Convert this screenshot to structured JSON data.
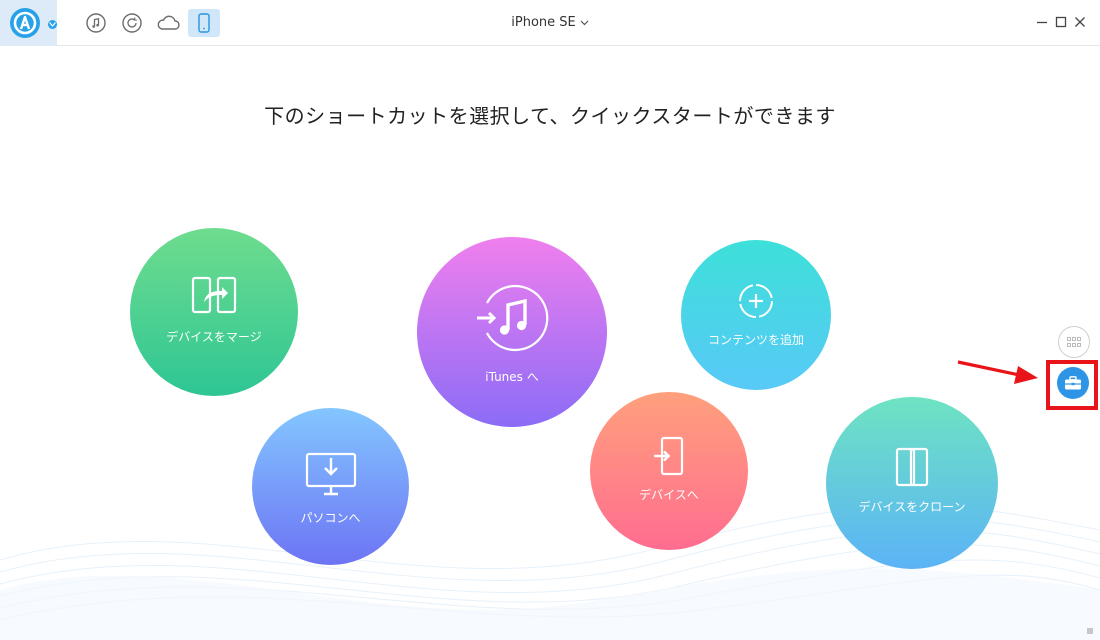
{
  "titlebar": {
    "device_name": "iPhone SE",
    "nav_icons": [
      "music-icon",
      "restore-icon",
      "cloud-icon",
      "device-icon"
    ],
    "window_controls": [
      "minimize-icon",
      "maximize-icon",
      "close-icon"
    ]
  },
  "main": {
    "headline": "下のショートカットを選択して、クイックスタートができます",
    "shortcuts": [
      {
        "label": "デバイスをマージ",
        "icon": "merge-device-icon"
      },
      {
        "label": "パソコンへ",
        "icon": "to-computer-icon"
      },
      {
        "label": "iTunes へ",
        "icon": "to-itunes-icon"
      },
      {
        "label": "コンテンツを追加",
        "icon": "add-content-icon"
      },
      {
        "label": "デバイスへ",
        "icon": "to-device-icon"
      },
      {
        "label": "デバイスをクローン",
        "icon": "clone-device-icon"
      }
    ]
  },
  "side": {
    "grid_icon": "grid-view-icon",
    "toolbox_icon": "toolbox-icon"
  },
  "annotation": {
    "highlight_color": "#e8141a"
  },
  "colors": {
    "accent": "#27a2ea",
    "toolbox": "#2e95e6"
  }
}
